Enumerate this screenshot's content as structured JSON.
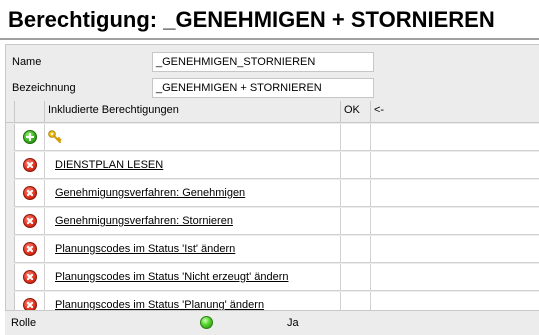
{
  "title": "Berechtigung: _GENEHMIGEN + STORNIEREN",
  "fields": {
    "name_label": "Name",
    "name_value": "_GENEHMIGEN_STORNIEREN",
    "bezeichnung_label": "Bezeichnung",
    "bezeichnung_value": "_GENEHMIGEN + STORNIEREN"
  },
  "grid": {
    "columns": {
      "included": "Inkludierte Berechtigungen",
      "ok": "OK",
      "arrow": "<-"
    },
    "rows": [
      {
        "label": "DIENSTPLAN LESEN",
        "icon": "delete-icon"
      },
      {
        "label": "Genehmigungsverfahren: Genehmigen",
        "icon": "delete-icon"
      },
      {
        "label": "Genehmigungsverfahren: Stornieren",
        "icon": "delete-icon"
      },
      {
        "label": "Planungscodes im Status 'Ist' ändern",
        "icon": "delete-icon"
      },
      {
        "label": "Planungscodes im Status 'Nicht erzeugt' ändern",
        "icon": "delete-icon"
      },
      {
        "label": "Planungscodes im Status 'Planung' ändern",
        "icon": "delete-icon"
      }
    ]
  },
  "footer": {
    "label": "Rolle",
    "value": "Ja",
    "status_color": "#3ec11a"
  },
  "colors": {
    "panel_bg": "#ececec",
    "delete_red": "#e0321e",
    "add_green": "#37b11c"
  }
}
